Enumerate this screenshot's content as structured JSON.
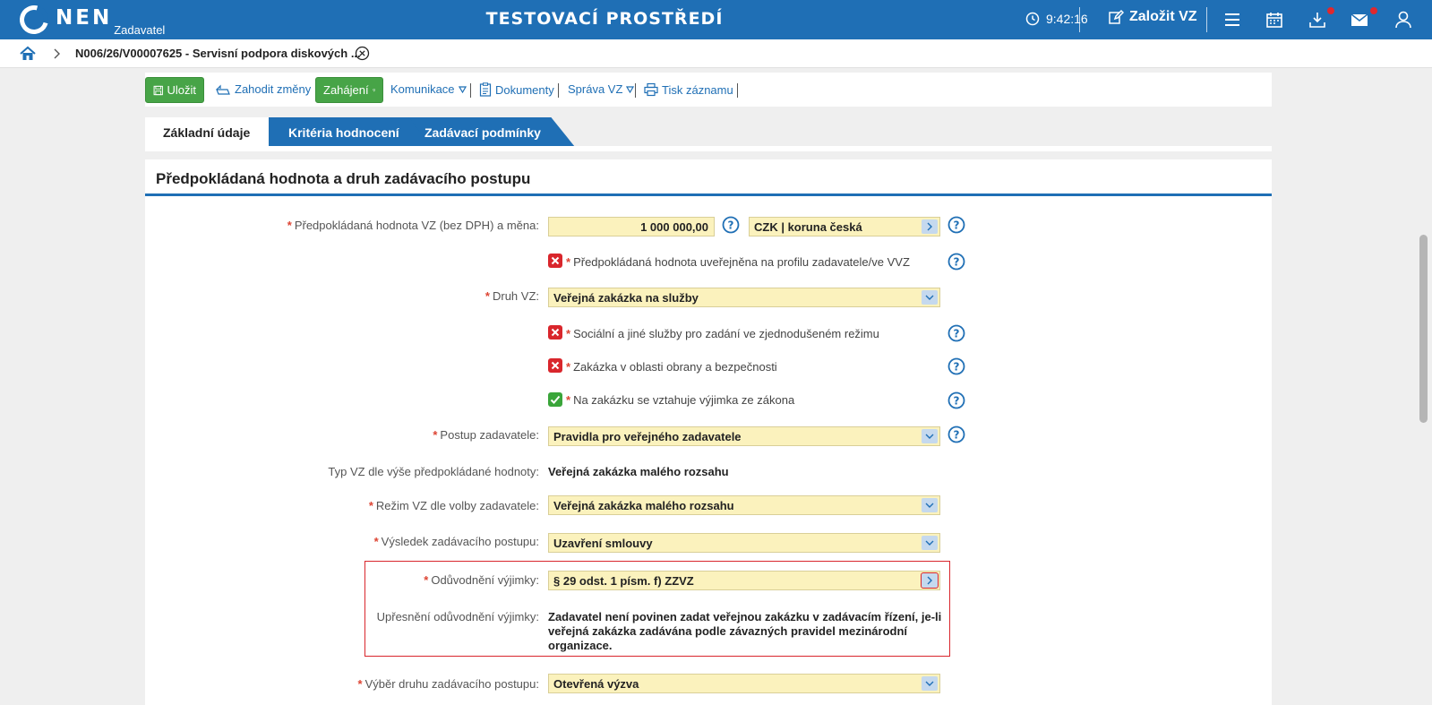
{
  "header": {
    "logo": "NEN",
    "logo_sub": "Zadavatel",
    "env_title": "TESTOVACÍ PROSTŘEDÍ",
    "time": "9:42:16",
    "create_label": "Založit VZ"
  },
  "breadcrumb": {
    "item": "N006/26/V00007625 - Servisní podpora diskových ..."
  },
  "toolbar": {
    "save": "Uložit",
    "discard": "Zahodit změny",
    "start": "Zahájení",
    "communication": "Komunikace",
    "documents": "Dokumenty",
    "management": "Správa VZ",
    "print": "Tisk záznamu"
  },
  "tabs": [
    "Základní údaje",
    "Kritéria hodnocení",
    "Zadávací podmínky"
  ],
  "section": {
    "title": "Předpokládaná hodnota a druh zadávacího postupu"
  },
  "form": {
    "value_label": "Předpokládaná hodnota VZ (bez DPH) a měna:",
    "value": "1 000 000,00",
    "currency": "CZK | koruna česká",
    "published_label": "Předpokládaná hodnota uveřejněna na profilu zadavatele/ve VVZ",
    "druh_label": "Druh VZ:",
    "druh_value": "Veřejná zakázka na služby",
    "social_label": "Sociální a jiné služby pro zadání ve zjednodušeném režimu",
    "defense_label": "Zakázka v oblasti obrany a bezpečnosti",
    "exception_label": "Na zakázku se vztahuje výjimka ze zákona",
    "postup_label": "Postup zadavatele:",
    "postup_value": "Pravidla pro veřejného zadavatele",
    "typ_label": "Typ VZ dle výše předpokládané hodnoty:",
    "typ_value": "Veřejná zakázka malého rozsahu",
    "rezim_label": "Režim VZ dle volby zadavatele:",
    "rezim_value": "Veřejná zakázka malého rozsahu",
    "vysledek_label": "Výsledek zadávacího postupu:",
    "vysledek_value": "Uzavření smlouvy",
    "oduvodneni_label": "Odůvodnění výjimky:",
    "oduvodneni_value": "§ 29 odst. 1 písm. f) ZZVZ",
    "upresneni_label": "Upřesnění odůvodnění výjimky:",
    "upresneni_line1": "Zadavatel není povinen zadat veřejnou zakázku v zadávacím řízení, je-li",
    "upresneni_line2": "veřejná zakázka zadávána podle závazných pravidel mezinárodní",
    "upresneni_line3": "organizace.",
    "vyber_label": "Výběr druhu zadávacího postupu:",
    "vyber_value": "Otevřená výzva"
  },
  "colors": {
    "brand": "#1f6fb5",
    "green": "#47a447",
    "field_bg": "#fbf2bd",
    "error_red": "#d9262c"
  }
}
